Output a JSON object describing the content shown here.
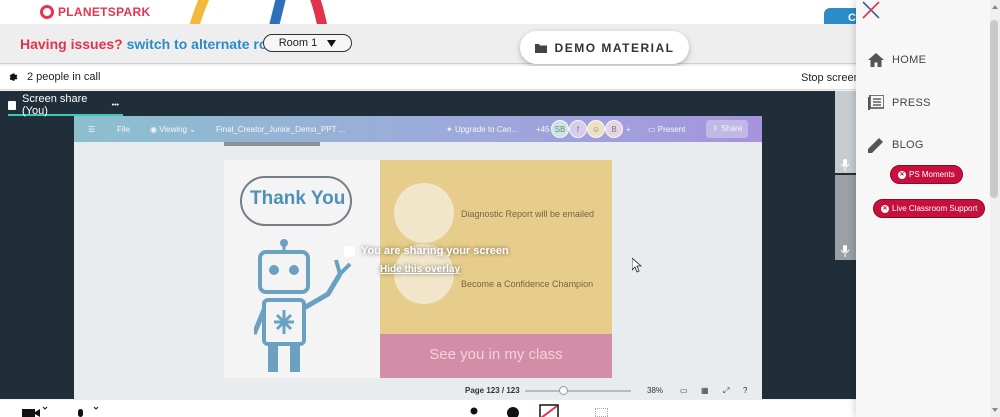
{
  "header": {
    "logo_text": "PLANETSPARK",
    "issues_text": "Having issues?",
    "switch_text": "switch to alternate room",
    "room_select_value": "Room 1",
    "demo_material_label": "DEMO MATERIAL",
    "blue_tab_text": "C"
  },
  "call": {
    "people_count_text": "2 people in call",
    "stop_screen_label": "Stop screen"
  },
  "screen_share": {
    "tab_label": "Screen share (You)",
    "tab_more": "•••",
    "overlay_message": "You are sharing your screen",
    "hide_overlay_link": "Hide this overlay"
  },
  "shared_app": {
    "menu_file": "File",
    "menu_viewing": "Viewing",
    "document_title": "Final_Creator_Junior_Demo_PPT ...",
    "upgrade_label": "Upgrade to Can...",
    "collaborator_count": "+45",
    "avatar_1": "SB",
    "avatar_2": "f",
    "avatar_4": "B",
    "add_label": "+",
    "present_label": "Present",
    "share_label": "Share",
    "page_indicator": "Page 123 / 123",
    "zoom_level": "38%",
    "help_label": "?"
  },
  "slide": {
    "title": "Thank You",
    "line_1": "Diagnostic Report will be emailed",
    "line_2": "Become a Confidence Champion",
    "footer": "See you in my class"
  },
  "side_menu": {
    "items": [
      {
        "label": "HOME"
      },
      {
        "label": "PRESS"
      },
      {
        "label": "BLOG"
      }
    ],
    "pill_1": "PS Moments",
    "pill_2": "Live Classroom Support"
  },
  "colors": {
    "brand_red": "#e0344d",
    "link_blue": "#2d8bc8",
    "video_bg": "#1f2e38",
    "pill_red": "#c8103e",
    "active_tab": "#3ec7b5"
  }
}
